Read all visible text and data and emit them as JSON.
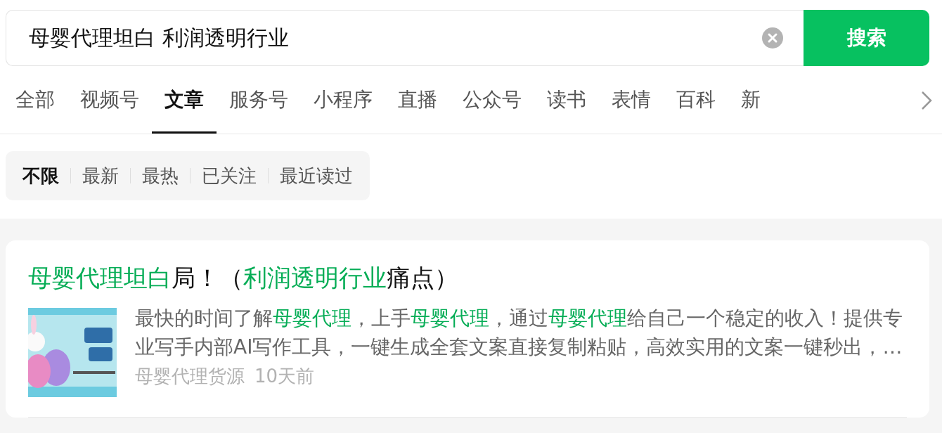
{
  "search": {
    "value": "母婴代理坦白 利润透明行业",
    "button": "搜索"
  },
  "tabs": [
    {
      "label": "全部",
      "selected": false
    },
    {
      "label": "视频号",
      "selected": false
    },
    {
      "label": "文章",
      "selected": true
    },
    {
      "label": "服务号",
      "selected": false
    },
    {
      "label": "小程序",
      "selected": false
    },
    {
      "label": "直播",
      "selected": false
    },
    {
      "label": "公众号",
      "selected": false
    },
    {
      "label": "读书",
      "selected": false
    },
    {
      "label": "表情",
      "selected": false
    },
    {
      "label": "百科",
      "selected": false
    },
    {
      "label": "新",
      "selected": false
    }
  ],
  "filters": [
    {
      "label": "不限",
      "selected": true
    },
    {
      "label": "最新",
      "selected": false
    },
    {
      "label": "最热",
      "selected": false
    },
    {
      "label": "已关注",
      "selected": false
    },
    {
      "label": "最近读过",
      "selected": false
    }
  ],
  "results": [
    {
      "title": [
        {
          "text": "母婴代理坦白",
          "highlight": true
        },
        {
          "text": "局！（",
          "highlight": false
        },
        {
          "text": "利润透明行业",
          "highlight": true
        },
        {
          "text": "痛点）",
          "highlight": false
        }
      ],
      "thumbnail": {
        "kind": "picture"
      },
      "description": [
        {
          "text": "最快的时间了解",
          "highlight": false
        },
        {
          "text": "母婴代理",
          "highlight": true
        },
        {
          "text": "，上手",
          "highlight": false
        },
        {
          "text": "母婴代理",
          "highlight": true
        },
        {
          "text": "，通过",
          "highlight": false
        },
        {
          "text": "母婴代理",
          "highlight": true
        },
        {
          "text": "给自己一个稳定的收入！提供专业写手内部AI写作工具，一键生成全套文案直接复制粘贴，高效实用的文案一键秒出，…",
          "highlight": false
        }
      ],
      "source": "母婴代理货源",
      "time": "10天前"
    }
  ]
}
